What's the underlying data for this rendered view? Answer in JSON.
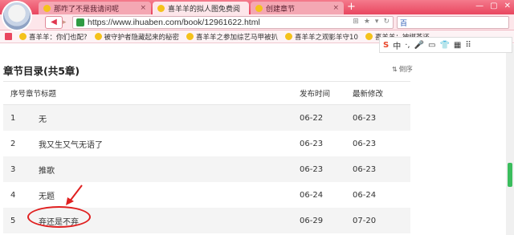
{
  "browser": {
    "tabs": [
      {
        "label": "那咋了不是我请问呢",
        "active": false
      },
      {
        "label": "喜羊羊的拟人图免费阅",
        "active": true
      },
      {
        "label": "创建章节",
        "active": false
      }
    ],
    "url": "https://www.ihuaben.com/book/12961622.html",
    "search_label": "百",
    "bookmarks": [
      "喜羊羊：你们也配?",
      "被守护者隐藏起来的秘密",
      "喜羊羊之参加综艺马甲被扒",
      "喜羊羊之观影羊守10",
      "喜羊羊：被绑茶还..."
    ],
    "ime_items": [
      "S",
      "中",
      "·,",
      "🎤",
      "▭",
      "👕",
      "▦",
      "⠿"
    ]
  },
  "page": {
    "title": "章节目录(共5章)",
    "order_label": "倒序",
    "headers": {
      "index": "序号",
      "name": "章节标题",
      "published": "发布时间",
      "modified": "最新修改"
    },
    "chapters": [
      {
        "index": "1",
        "name": "无",
        "published": "06-22",
        "modified": "06-23"
      },
      {
        "index": "2",
        "name": "我又生又气无语了",
        "published": "06-23",
        "modified": "06-23"
      },
      {
        "index": "3",
        "name": "推歌",
        "published": "06-23",
        "modified": "06-23"
      },
      {
        "index": "4",
        "name": "无题",
        "published": "06-24",
        "modified": "06-24"
      },
      {
        "index": "5",
        "name": "弃还是不弃",
        "published": "06-29",
        "modified": "07-20"
      }
    ]
  },
  "colors": {
    "accent": "#e9465f",
    "annotation": "#e02020",
    "scroll_thumb": "#3bbd5d"
  }
}
